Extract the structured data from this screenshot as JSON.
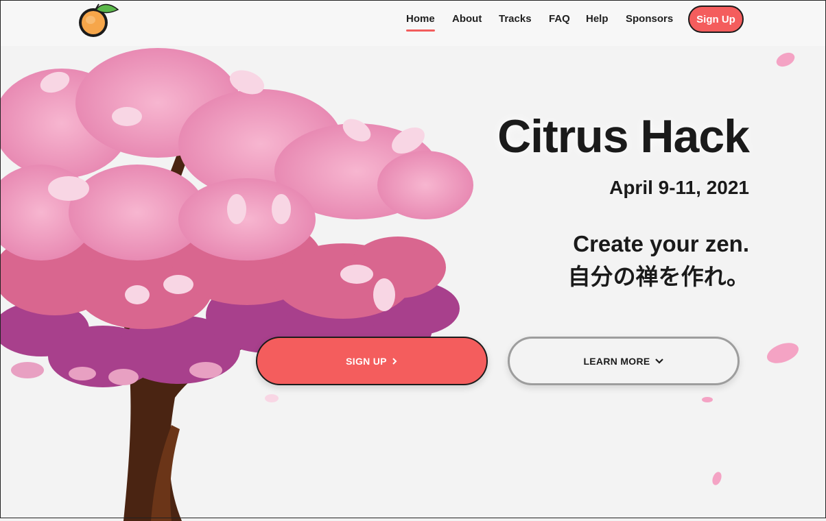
{
  "nav": {
    "logo_icon": "orange-fruit-logo",
    "links": [
      {
        "label": "Home",
        "active": true
      },
      {
        "label": "About",
        "active": false
      },
      {
        "label": "Tracks",
        "active": false
      },
      {
        "label": "FAQ",
        "active": false
      },
      {
        "label": "Help",
        "active": false
      },
      {
        "label": "Sponsors",
        "active": false
      }
    ],
    "signup_label": "Sign Up"
  },
  "hero": {
    "title": "Citrus Hack",
    "date": "April 9-11, 2021",
    "tagline_en": "Create your zen.",
    "tagline_jp": "自分の禅を作れ。"
  },
  "cta": {
    "signup_label": "SIGN UP",
    "signup_icon": "chevron-right-icon",
    "learn_label": "LEARN MORE",
    "learn_icon": "chevron-down-icon"
  },
  "colors": {
    "accent": "#f45d5d",
    "background": "#f3f3f3",
    "text": "#1a1a1a",
    "blossom_pink": "#f4a3c4",
    "blossom_magenta": "#a8408c",
    "trunk": "#4a2412"
  }
}
